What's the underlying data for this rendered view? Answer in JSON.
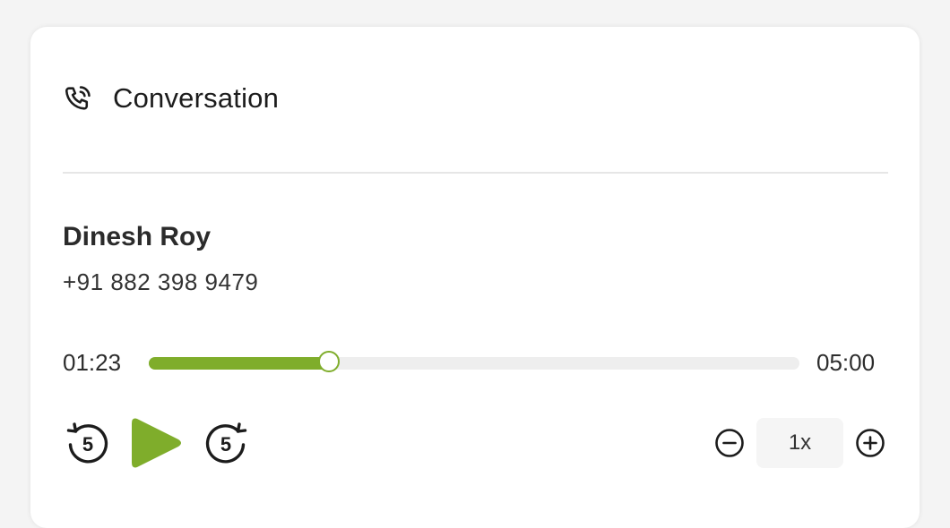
{
  "header": {
    "title": "Conversation",
    "icon": "phone-call-icon"
  },
  "contact": {
    "name": "Dinesh Roy",
    "phone": "+91 882 398 9479"
  },
  "player": {
    "current_time": "01:23",
    "total_time": "05:00",
    "progress_fraction": 0.2767,
    "accent_color": "#7fad2b",
    "rewind_icon": "rewind-5-icon",
    "play_icon": "play-icon",
    "forward_icon": "forward-5-icon"
  },
  "speed": {
    "value": "1x",
    "decrease_icon": "minus-circle-icon",
    "increase_icon": "plus-circle-icon"
  }
}
